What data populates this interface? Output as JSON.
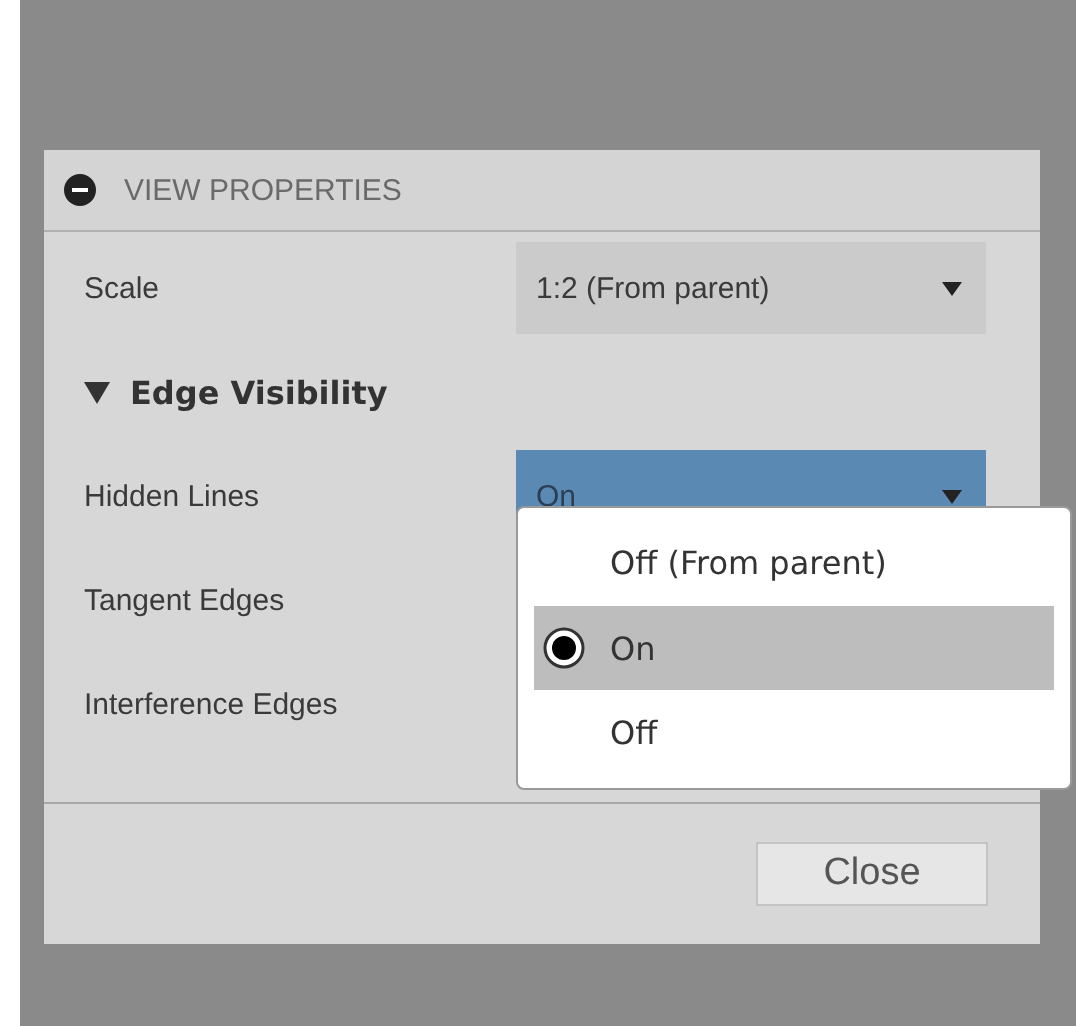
{
  "panel": {
    "title": "VIEW PROPERTIES"
  },
  "rows": [
    {
      "kind": "dropdown",
      "label": "Scale",
      "value": "1:2 (From parent)",
      "focused": false
    },
    {
      "kind": "section",
      "label": "Edge Visibility",
      "expanded": true
    },
    {
      "kind": "dropdown",
      "label": "Hidden Lines",
      "value": "On",
      "focused": true
    },
    {
      "kind": "label",
      "label": "Tangent Edges"
    },
    {
      "kind": "label",
      "label": "Interference Edges"
    }
  ],
  "popup": {
    "options": [
      {
        "label": "Off (From parent)",
        "selected": false
      },
      {
        "label": "On",
        "selected": true
      },
      {
        "label": "Off",
        "selected": false
      }
    ]
  },
  "buttons": [
    "Close"
  ]
}
